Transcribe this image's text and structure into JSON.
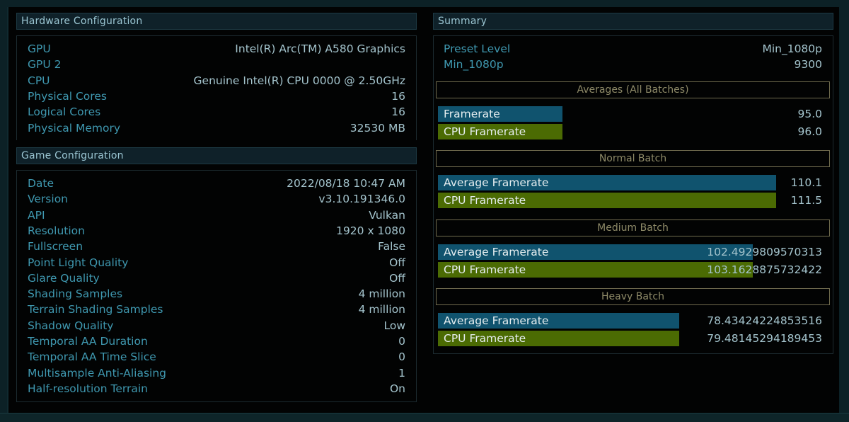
{
  "hardware": {
    "title": "Hardware Configuration",
    "rows": [
      {
        "label": "GPU",
        "value": "Intel(R) Arc(TM) A580 Graphics"
      },
      {
        "label": "GPU 2",
        "value": ""
      },
      {
        "label": "CPU",
        "value": "Genuine Intel(R) CPU 0000 @ 2.50GHz"
      },
      {
        "label": "Physical Cores",
        "value": "16"
      },
      {
        "label": "Logical Cores",
        "value": "16"
      },
      {
        "label": "Physical Memory",
        "value": "32530 MB"
      }
    ]
  },
  "game": {
    "title": "Game Configuration",
    "rows": [
      {
        "label": "Date",
        "value": "2022/08/18 10:47 AM"
      },
      {
        "label": "Version",
        "value": "v3.10.191346.0"
      },
      {
        "label": "API",
        "value": "Vulkan"
      },
      {
        "label": "Resolution",
        "value": "1920 x 1080"
      },
      {
        "label": "Fullscreen",
        "value": "False"
      },
      {
        "label": "Point Light Quality",
        "value": "Off"
      },
      {
        "label": "Glare Quality",
        "value": "Off"
      },
      {
        "label": "Shading Samples",
        "value": "4 million"
      },
      {
        "label": "Terrain Shading Samples",
        "value": "4 million"
      },
      {
        "label": "Shadow Quality",
        "value": "Low"
      },
      {
        "label": "Temporal AA Duration",
        "value": "0"
      },
      {
        "label": "Temporal AA Time Slice",
        "value": "0"
      },
      {
        "label": "Multisample Anti-Aliasing",
        "value": "1"
      },
      {
        "label": "Half-resolution Terrain",
        "value": "On"
      }
    ]
  },
  "summary": {
    "title": "Summary",
    "rows": [
      {
        "label": "Preset Level",
        "value": "Min_1080p"
      },
      {
        "label": "Min_1080p",
        "value": "9300"
      }
    ],
    "colors": {
      "framerate_bar": "#10536e",
      "cpu_bar": "#4b6b03",
      "batch_border": "#706b4e"
    },
    "batches": [
      {
        "title": "Averages (All Batches)",
        "bars": [
          {
            "label": "Framerate",
            "value": "95.0",
            "fill_fraction": 0.325,
            "color": "blue"
          },
          {
            "label": "CPU Framerate",
            "value": "96.0",
            "fill_fraction": 0.325,
            "color": "green"
          }
        ]
      },
      {
        "title": "Normal Batch",
        "bars": [
          {
            "label": "Average Framerate",
            "value": "110.1",
            "fill_fraction": 0.88,
            "color": "blue"
          },
          {
            "label": "CPU Framerate",
            "value": "111.5",
            "fill_fraction": 0.88,
            "color": "green"
          }
        ]
      },
      {
        "title": "Medium Batch",
        "bars": [
          {
            "label": "Average Framerate",
            "value": "102.4929809570313",
            "fill_fraction": 0.82,
            "color": "blue"
          },
          {
            "label": "CPU Framerate",
            "value": "103.1628875732422",
            "fill_fraction": 0.82,
            "color": "green"
          }
        ]
      },
      {
        "title": "Heavy Batch",
        "bars": [
          {
            "label": "Average Framerate",
            "value": "78.43424224853516",
            "fill_fraction": 0.628,
            "color": "blue"
          },
          {
            "label": "CPU Framerate",
            "value": "79.48145294189453",
            "fill_fraction": 0.628,
            "color": "green"
          }
        ]
      }
    ]
  }
}
